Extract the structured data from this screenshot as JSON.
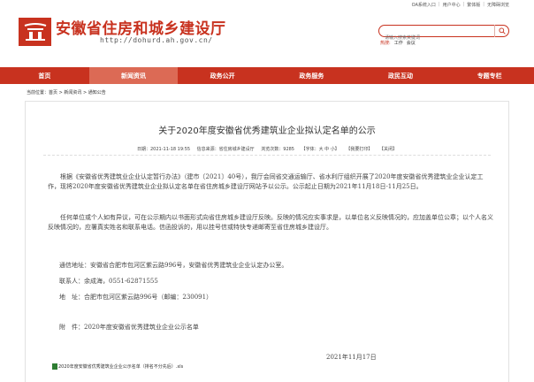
{
  "util": {
    "links": [
      "OA系统入口",
      "用户中心",
      "繁体版",
      "无障碍浏览"
    ]
  },
  "header": {
    "title": "安徽省住房和城乡建设厅",
    "url": "http://dohurd.ah.gov.cn/",
    "search_placeholder": "请输入搜索关键词",
    "hot_label": "热搜:",
    "hot_items": [
      "工作",
      "会议"
    ]
  },
  "nav": {
    "items": [
      "首页",
      "新闻资讯",
      "政务公开",
      "政务服务",
      "政民互动",
      "专题专栏"
    ],
    "active_index": 1
  },
  "breadcrumb": "当前位置：首页 > 新闻资讯 > 通知公告",
  "article": {
    "title": "关于2020年度安徽省优秀建筑业企业拟认定名单的公示",
    "meta": {
      "date": "日期：2021-11-18 19:55",
      "source": "信息来源：省住房城乡建设厅",
      "views": "浏览次数：9285",
      "font": "【字体：大 中 小】",
      "print": "【我要打印】",
      "close": "【关闭】"
    },
    "para1": "根据《安徽省优秀建筑业企业认定暂行办法》（建市〔2021〕40号），我厅会同省交通运输厅、省水利厅组织开展了2020年度安徽省优秀建筑业企业认定工作，现将2020年度安徽省优秀建筑业企业拟认定名单在省住房城乡建设厅网站予以公示。公示起止日期为2021年11月18日-11月25日。",
    "para2": "任何单位或个人如有异议，可在公示期内以书面形式向省住房城乡建设厅反映。反映的情况应实事求是，以单位名义反映情况的，应加盖单位公章；以个人名义反映情况的，应署真实姓名和联系电话。信函投诉的，用以挂号信或特快专递邮寄至省住房城乡建设厅。",
    "address": "通信地址：安徽省合肥市包河区紫云路996号，安徽省优秀建筑业企业认定办公室。",
    "contact": "联系人：余成海，0551-62871555",
    "location": "地　址：合肥市包河区紫云路996号（邮编：230091）",
    "attachment": "附　件：2020年度安徽省优秀建筑业企业公示名单",
    "date_sign": "2021年11月17日",
    "attachment_file": "2020年度安徽省优秀建筑业企业公示名单（排名不分先后）.xls"
  }
}
